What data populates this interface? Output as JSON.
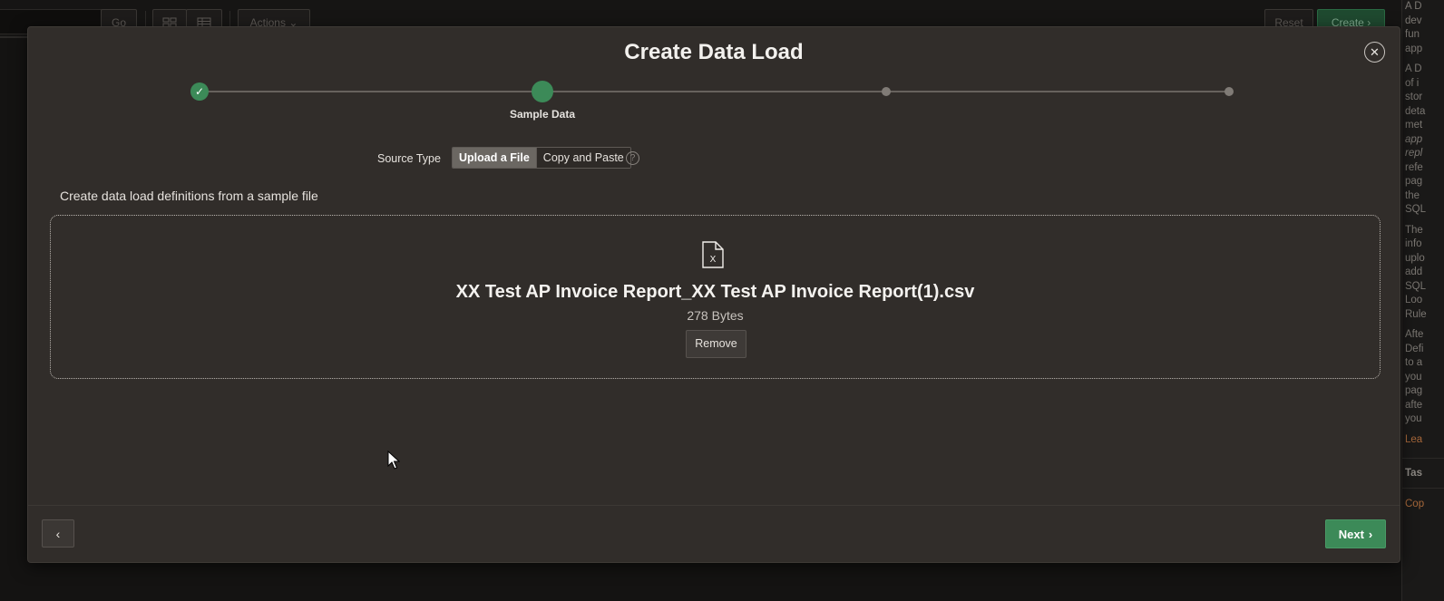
{
  "background": {
    "go_label": "Go",
    "grid_view_icon": "grid-icon",
    "table_view_icon": "table-icon",
    "actions_label": "Actions",
    "reset_label": "Reset",
    "create_label": "Create",
    "help_panel": {
      "lines": [
        "A D",
        "dev",
        "fun",
        "app",
        "A D",
        "of i",
        "stor",
        "deta",
        "met",
        "app",
        "repl",
        "refe",
        "pag",
        "the",
        "SQL",
        "The",
        "info",
        "uplo",
        "add",
        "SQL",
        "Loo",
        "Rule",
        "Afte",
        "Defi",
        "to a",
        "you",
        "pag",
        "afte",
        "you"
      ],
      "learn_more": "Lea",
      "tasks_title": "Tas",
      "task_link": "Cop"
    }
  },
  "dialog": {
    "title": "Create Data Load",
    "close_icon": "close-icon",
    "wizard": {
      "current_step_label": "Sample Data",
      "steps": [
        "complete",
        "current",
        "pending",
        "pending"
      ]
    },
    "source_type": {
      "label": "Source Type",
      "options": [
        "Upload a File",
        "Copy and Paste"
      ],
      "selected": "Upload a File"
    },
    "instruction": "Create data load definitions from a sample file",
    "file": {
      "name": "XX Test AP Invoice Report_XX Test AP Invoice Report(1).csv",
      "size": "278 Bytes",
      "icon_letter": "X",
      "remove_label": "Remove"
    },
    "footer": {
      "previous_icon": "chevron-left-icon",
      "next_label": "Next"
    }
  },
  "colors": {
    "accent": "#3c8a58",
    "dialog_bg": "#312d2a",
    "page_bg": "#141312"
  }
}
